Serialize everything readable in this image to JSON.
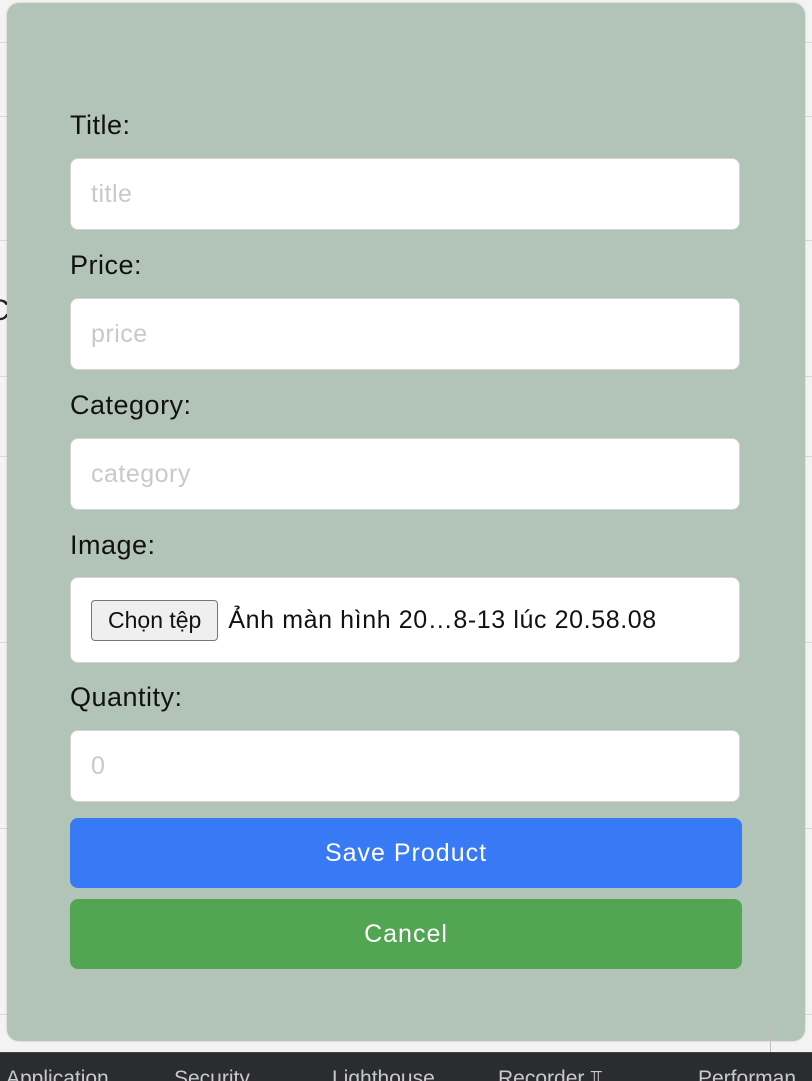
{
  "form": {
    "title_label": "Title:",
    "title_placeholder": "title",
    "price_label": "Price:",
    "price_placeholder": "price",
    "category_label": "Category:",
    "category_placeholder": "category",
    "image_label": "Image:",
    "file_button_label": "Chọn tệp",
    "file_name": "Ảnh màn hình 20…8-13 lúc 20.58.08",
    "quantity_label": "Quantity:",
    "quantity_placeholder": "0",
    "save_label": "Save Product",
    "cancel_label": "Cancel"
  },
  "devtools": {
    "tabs": [
      "Application",
      "Security",
      "Lighthouse",
      "Recorder ⫪",
      "Performan"
    ]
  },
  "colors": {
    "modal_bg": "#b2c4b7",
    "save_button": "#3879f6",
    "cancel_button": "#52a553"
  }
}
